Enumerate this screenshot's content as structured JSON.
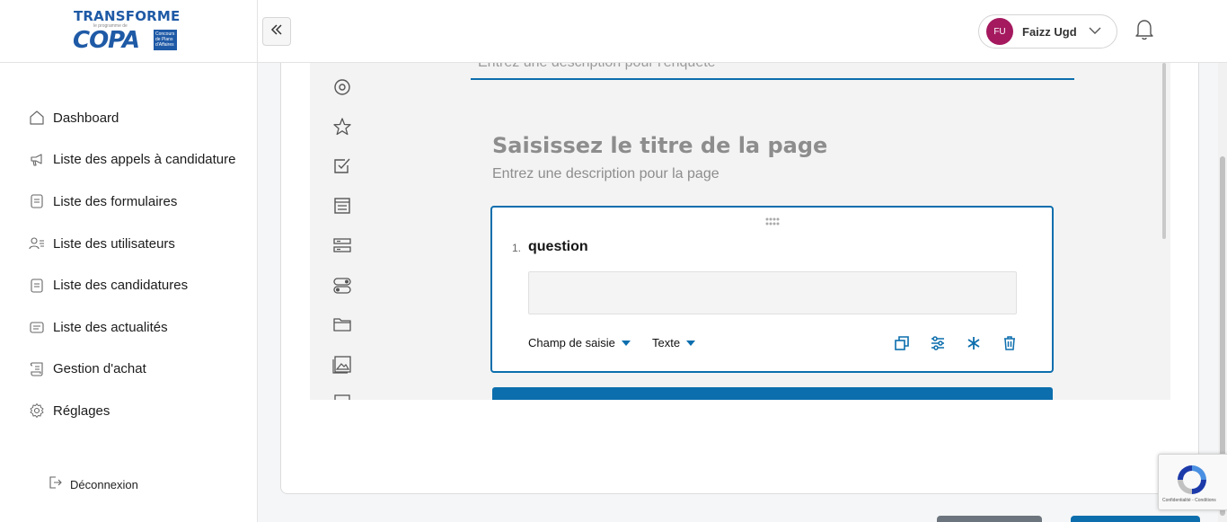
{
  "brand": {
    "logo_top": "TRANSFORME",
    "logo_sub": "le programme de",
    "logo_main": "COPA",
    "logo_box": "Concours de Plans d'Affaires"
  },
  "sidebar": {
    "items": [
      {
        "label": "Dashboard",
        "icon": "home-icon"
      },
      {
        "label": "Liste des appels à candidature",
        "icon": "megaphone-icon"
      },
      {
        "label": "Liste des formulaires",
        "icon": "form-icon"
      },
      {
        "label": "Liste des utilisateurs",
        "icon": "users-icon"
      },
      {
        "label": "Liste des candidatures",
        "icon": "document-icon"
      },
      {
        "label": "Liste des actualités",
        "icon": "news-icon"
      },
      {
        "label": "Gestion d'achat",
        "icon": "receipt-icon"
      },
      {
        "label": "Réglages",
        "icon": "gear-icon"
      }
    ],
    "logout": "Déconnexion"
  },
  "header": {
    "user_initials": "FU",
    "user_name": "Faizz Ugd",
    "avatar_color": "#a5195f"
  },
  "editor": {
    "survey_description_placeholder": "Entrez une description pour l'enquête",
    "page_title_placeholder": "Saisissez le titre de la page",
    "page_description_placeholder": "Entrez une description pour la page",
    "question": {
      "number": "1.",
      "title": "question",
      "input_type": "Champ de saisie",
      "value_type": "Texte"
    },
    "toolbox": [
      "radio-icon",
      "star-icon",
      "checkbox-icon",
      "text-icon",
      "multi-text-icon",
      "toggle-icon",
      "folder-icon",
      "image-icon"
    ]
  },
  "recaptcha": {
    "footer": "Confidentialité - Conditions"
  },
  "colors": {
    "accent": "#0c6ead",
    "brand_blue": "#1f5aa6"
  }
}
